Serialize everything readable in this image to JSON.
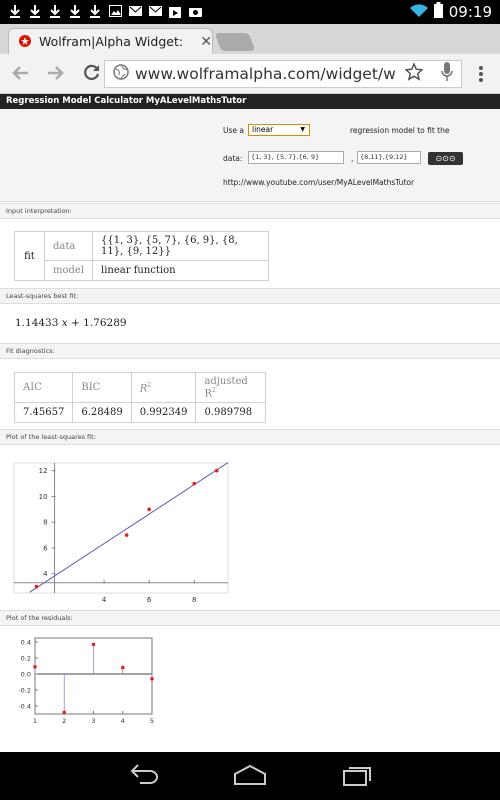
{
  "status_bar": {
    "time": "09:19"
  },
  "browser": {
    "tab_title": "Wolfram|Alpha Widget:",
    "tab_close": "✕",
    "url": "www.wolframalpha.com/widget/widge"
  },
  "widget": {
    "header": "Regression Model Calculator MyALevelMathsTutor",
    "use_a_label": "Use a",
    "model_select": "linear",
    "regression_text": "regression model to fit the",
    "data_label": "data:",
    "data_input_1": "{1, 3}, {5, 7},{6, 9}",
    "comma": ",",
    "data_input_2": "{8,11},{9,12}",
    "go_label": "⊙⊙⊙",
    "youtube_url": "http://www.youtube.com/user/MyALevelMathsTutor"
  },
  "pods": {
    "input_interpretation": {
      "title": "Input interpretation:",
      "fit": "fit",
      "data_label": "data",
      "data_value": "{{1, 3}, {5, 7}, {6, 9}, {8, 11}, {9, 12}}",
      "model_label": "model",
      "model_value": "linear function"
    },
    "best_fit": {
      "title": "Least-squares best fit:",
      "expression_a": "1.14433",
      "expression_x": "x",
      "expression_b": "+ 1.76289"
    },
    "diagnostics": {
      "title": "Fit diagnostics:",
      "headers": [
        "AIC",
        "BIC",
        "R",
        "adjusted R"
      ],
      "superscript": "2",
      "values": [
        "7.45657",
        "6.28489",
        "0.992349",
        "0.989798"
      ]
    },
    "plot_fit": {
      "title": "Plot of the least-squares fit:",
      "x_ticks": [
        "4",
        "6",
        "8"
      ],
      "y_ticks": [
        "4",
        "6",
        "8",
        "10",
        "12"
      ]
    },
    "plot_residuals": {
      "title": "Plot of the residuals:",
      "x_ticks": [
        "1",
        "2",
        "3",
        "4",
        "5"
      ],
      "y_ticks": [
        "0.4",
        "0.2",
        "0.0",
        "-0.2",
        "-0.4"
      ]
    }
  },
  "chart_data": [
    {
      "type": "scatter",
      "title": "Plot of the least-squares fit:",
      "points": [
        [
          1,
          3
        ],
        [
          5,
          7
        ],
        [
          6,
          9
        ],
        [
          8,
          11
        ],
        [
          9,
          12
        ]
      ],
      "fit_line": {
        "slope": 1.14433,
        "intercept": 1.76289
      },
      "xlim": [
        0,
        9.5
      ],
      "ylim": [
        2.5,
        12.6
      ],
      "x_ticks": [
        4,
        6,
        8
      ],
      "y_ticks": [
        4,
        6,
        8,
        10,
        12
      ],
      "point_color": "#e8201a",
      "line_color": "#5b5bb8"
    },
    {
      "type": "scatter",
      "title": "Plot of the residuals:",
      "x": [
        1,
        2,
        3,
        4,
        5
      ],
      "values": [
        0.09,
        -0.48,
        0.37,
        0.08,
        -0.06
      ],
      "xlim": [
        1,
        5
      ],
      "ylim": [
        -0.5,
        0.45
      ],
      "x_ticks": [
        1,
        2,
        3,
        4,
        5
      ],
      "y_ticks": [
        0.4,
        0.2,
        0.0,
        -0.2,
        -0.4
      ],
      "point_color": "#e8201a",
      "stem_color": "#8888dd"
    }
  ]
}
